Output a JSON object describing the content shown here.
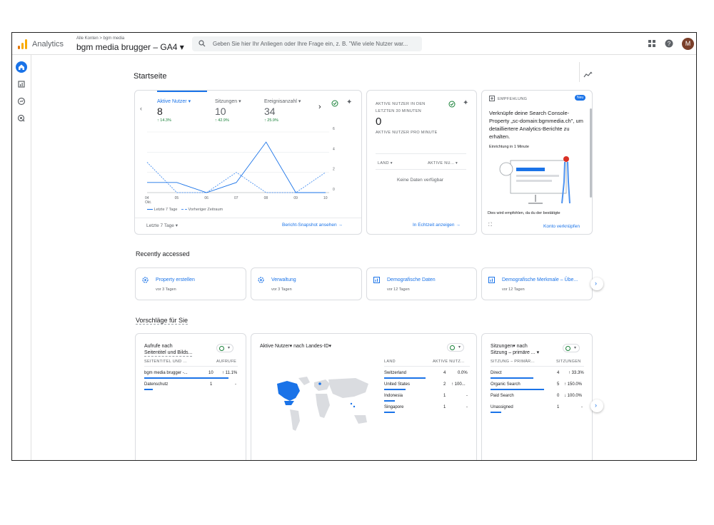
{
  "header": {
    "app_name": "Analytics",
    "breadcrumb": "Alle Konten > bgm media",
    "property": "bgm media brugger  – GA4 ▾",
    "search_placeholder": "Geben Sie hier Ihr Anliegen oder Ihre Frage ein, z. B. \"Wie viele Nutzer war...",
    "avatar_letter": "M"
  },
  "page": {
    "title": "Startseite"
  },
  "overview": {
    "metrics": [
      {
        "label": "Aktive Nutzer ▾",
        "value": "8",
        "change": "↑ 14.3%"
      },
      {
        "label": "Sitzungen ▾",
        "value": "10",
        "change": "↑ 42.9%"
      },
      {
        "label": "Ereignisanzahl ▾",
        "value": "34",
        "change": "↑ 25.9%"
      }
    ],
    "range": "Letzte 7 Tage ▾",
    "link": "Bericht-Snapshot ansehen →",
    "legend": [
      "Letzte 7 Tage",
      "Vorheriger Zeitraum"
    ]
  },
  "chart_data": {
    "type": "line",
    "x": [
      "04",
      "05",
      "06",
      "07",
      "08",
      "09",
      "10"
    ],
    "x_sublabel": "Okt.",
    "series": [
      {
        "name": "Letzte 7 Tage",
        "values": [
          1,
          1,
          0,
          1,
          5,
          0,
          0
        ]
      },
      {
        "name": "Vorheriger Zeitraum",
        "values": [
          3,
          0,
          0,
          2,
          0,
          0,
          2
        ]
      }
    ],
    "yticks": [
      "6",
      "4",
      "2",
      "0"
    ],
    "ylim": [
      0,
      6
    ]
  },
  "realtime": {
    "title1": "AKTIVE NUTZER IN DEN",
    "title2": "LETZTEN 30 MINUTEN",
    "value": "0",
    "subtitle": "AKTIVE NUTZER PRO MINUTE",
    "col1": "LAND ▾",
    "col2": "AKTIVE NU... ▾",
    "empty": "Keine Daten verfügbar",
    "link": "In Echtzeit anzeigen →"
  },
  "recommendation": {
    "tag": "EMPFEHLUNG",
    "badge": "Neu",
    "text": "Verknüpfe deine Search Console-Property „sc-domain:bgmmedia.ch\", um detailliertere Analytics-Berichte zu erhalten.",
    "sub": "Einrichtung in 1 Minute",
    "footer": "Dies wird empfohlen, da du der bestätigte",
    "link": "Konto verknüpfen"
  },
  "recent": {
    "title": "Recently accessed",
    "items": [
      {
        "label": "Property erstellen",
        "time": "vor 3 Tagen"
      },
      {
        "label": "Verwaltung",
        "time": "vor 3 Tagen"
      },
      {
        "label": "Demografische Daten",
        "time": "vor 12 Tagen"
      },
      {
        "label": "Demografische Merkmale – Übe...",
        "time": "vor 12 Tagen"
      }
    ]
  },
  "suggestions": {
    "title": "Vorschläge für Sie"
  },
  "pages_card": {
    "title1": "Aufrufe nach",
    "title2": "Seitentitel und Bilds...",
    "col1": "SEITENTITEL UND ...",
    "col2": "AUFRUFE",
    "rows": [
      {
        "name": "bgm media brugger -...",
        "value": "10",
        "change": "↑ 11.1%"
      },
      {
        "name": "Datenschutz",
        "value": "1",
        "change": "-"
      }
    ]
  },
  "map_card": {
    "title": "Aktive Nutzer▾ nach Landes-ID▾",
    "col1": "LAND",
    "col2": "AKTIVE NUTZ...",
    "rows": [
      {
        "name": "Switzerland",
        "value": "4",
        "change": "0.0%"
      },
      {
        "name": "United States",
        "value": "2",
        "change": "↑ 100..."
      },
      {
        "name": "Indonesia",
        "value": "1",
        "change": "-"
      },
      {
        "name": "Singapore",
        "value": "1",
        "change": "-"
      }
    ]
  },
  "sessions_card": {
    "title1": "Sitzungen▾ nach",
    "title2": "Sitzung – primäre ... ▾",
    "col1": "SITZUNG – PRIMÄR...",
    "col2": "SITZUNGEN",
    "rows": [
      {
        "name": "Direct",
        "value": "4",
        "change": "↑ 33.3%"
      },
      {
        "name": "Organic Search",
        "value": "5",
        "change": "↑ 150.0%"
      },
      {
        "name": "Paid Search",
        "value": "0",
        "change": "↓ 100.0%"
      },
      {
        "name": "Unassigned",
        "value": "1",
        "change": "-"
      }
    ]
  }
}
